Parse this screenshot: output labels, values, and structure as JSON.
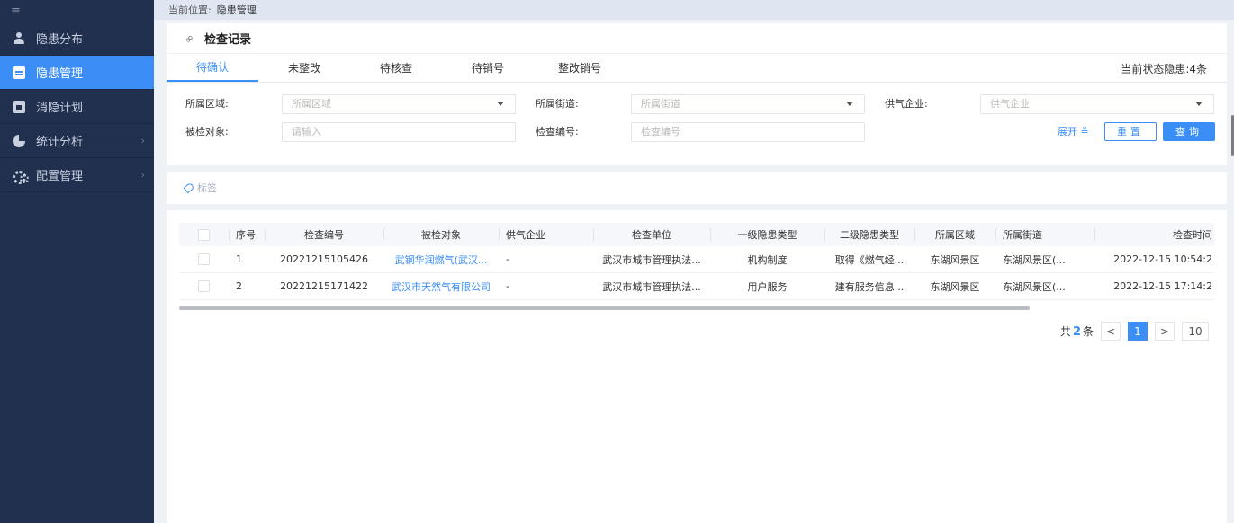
{
  "sidebar": {
    "menu_icon": "≡",
    "items": [
      {
        "label": "隐患分布",
        "icon": "user-pin-icon",
        "has_children": false
      },
      {
        "label": "隐患管理",
        "icon": "board-icon",
        "has_children": false
      },
      {
        "label": "消隐计划",
        "icon": "calendar-icon",
        "has_children": false
      },
      {
        "label": "统计分析",
        "icon": "pie-icon",
        "has_children": true
      },
      {
        "label": "配置管理",
        "icon": "gear-icon",
        "has_children": true
      }
    ],
    "chevron": "›"
  },
  "breadcrumb": {
    "prefix": "当前位置:",
    "current": "隐患管理"
  },
  "section": {
    "title": "检查记录",
    "link_icon": "∞"
  },
  "tabs": {
    "items": [
      "待确认",
      "未整改",
      "待核查",
      "待销号",
      "整改销号"
    ],
    "status": "当前状态隐患:4条"
  },
  "filters": {
    "region_label": "所属区域:",
    "region_placeholder": "所属区域",
    "street_label": "所属街道:",
    "street_placeholder": "所属街道",
    "supplier_label": "供气企业:",
    "supplier_placeholder": "供气企业",
    "target_label": "被检对象:",
    "target_placeholder": "请输入",
    "code_label": "检查编号:",
    "code_placeholder": "检查编号",
    "expand": "展开 ≚",
    "reset": "重置",
    "query": "查询"
  },
  "tagbar": {
    "label": "标签"
  },
  "table": {
    "headers": [
      "序号",
      "检查编号",
      "被检对象",
      "供气企业",
      "检查单位",
      "一级隐患类型",
      "二级隐患类型",
      "所属区域",
      "所属街道",
      "检查时间"
    ],
    "rows": [
      {
        "no": "1",
        "code": "20221215105426",
        "target": "武钢华润燃气(武汉...",
        "supplier": "-",
        "unit": "武汉市城市管理执法...",
        "type1": "机构制度",
        "type2": "取得《燃气经...",
        "region": "东湖风景区",
        "street": "东湖风景区(...",
        "time": "2022-12-15 10:54:2"
      },
      {
        "no": "2",
        "code": "20221215171422",
        "target": "武汉市天然气有限公司",
        "supplier": "-",
        "unit": "武汉市城市管理执法...",
        "type1": "用户服务",
        "type2": "建有服务信息...",
        "region": "东湖风景区",
        "street": "东湖风景区(...",
        "time": "2022-12-15 17:14:2"
      }
    ]
  },
  "pagination": {
    "total_prefix": "共",
    "total": "2",
    "total_suffix": "条",
    "prev": "<",
    "page": "1",
    "next": ">",
    "size": "10"
  }
}
